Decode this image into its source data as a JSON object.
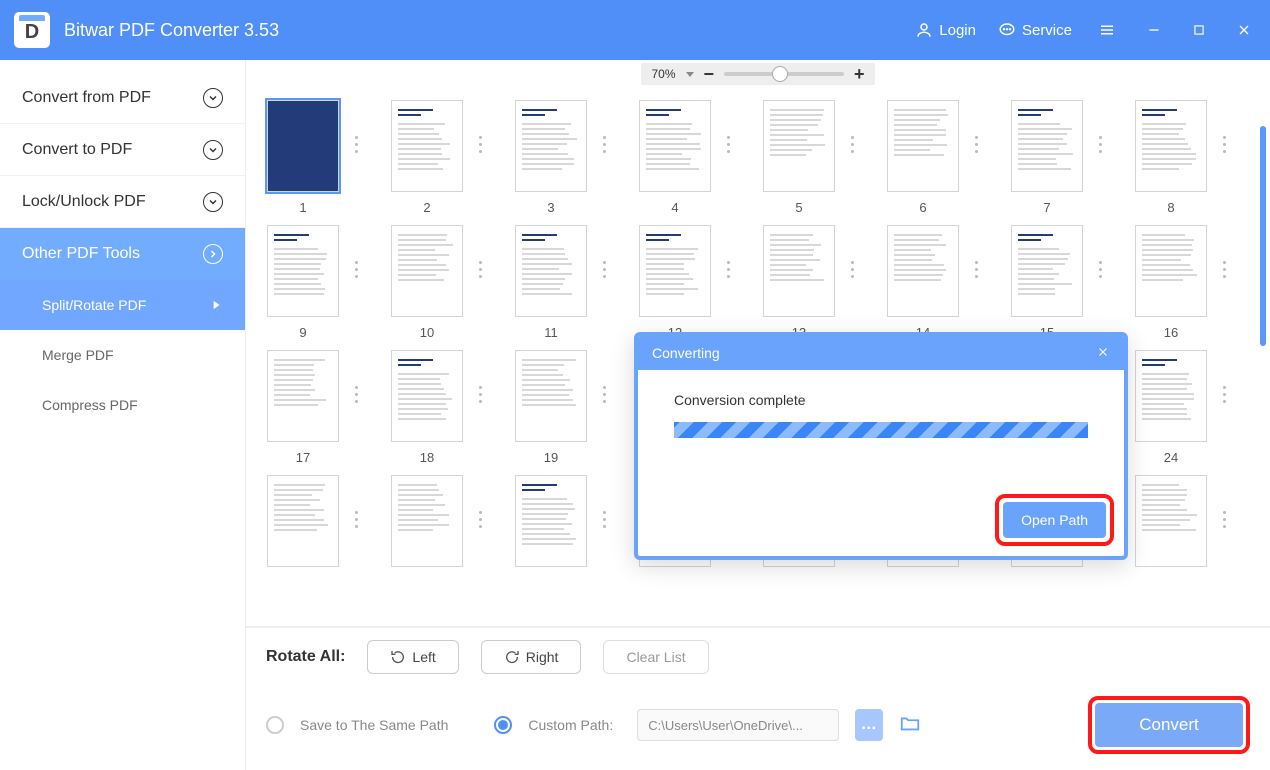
{
  "app": {
    "title": "Bitwar PDF Converter 3.53",
    "logo_letter": "D"
  },
  "header": {
    "login": "Login",
    "service": "Service"
  },
  "sidebar": {
    "items": [
      {
        "label": "Convert from PDF"
      },
      {
        "label": "Convert to PDF"
      },
      {
        "label": "Lock/Unlock PDF"
      },
      {
        "label": "Other PDF Tools",
        "active": true
      }
    ],
    "subitems": [
      {
        "label": "Split/Rotate PDF",
        "active": true
      },
      {
        "label": "Merge PDF"
      },
      {
        "label": "Compress PDF"
      }
    ]
  },
  "zoom": {
    "value": "70%"
  },
  "thumbnails": {
    "count": 24
  },
  "modal": {
    "title": "Converting",
    "message": "Conversion complete",
    "button": "Open Path"
  },
  "toolbar": {
    "rotate_label": "Rotate All:",
    "rotate_left": "Left",
    "rotate_right": "Right",
    "clear_list": "Clear List"
  },
  "save": {
    "save_same": "Save to The Same Path",
    "custom_path": "Custom Path:",
    "path_value": "C:\\Users\\User\\OneDrive\\...",
    "convert": "Convert"
  }
}
